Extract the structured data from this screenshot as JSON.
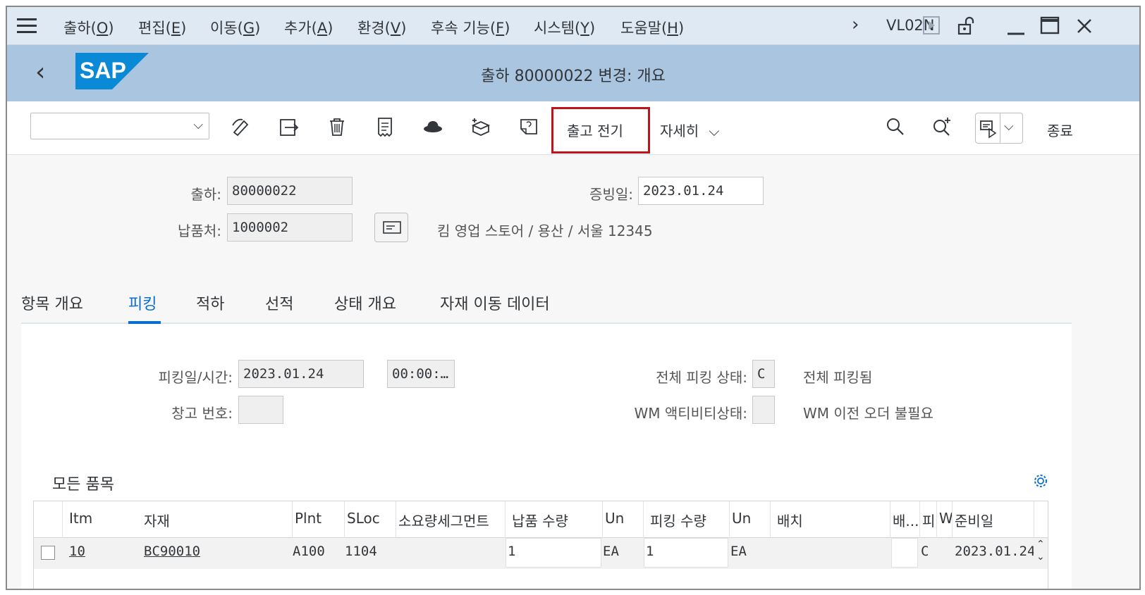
{
  "menu": {
    "items": [
      {
        "text": "출하(",
        "key": "O",
        "end": ")"
      },
      {
        "text": "편집(",
        "key": "E",
        "end": ")"
      },
      {
        "text": "이동(",
        "key": "G",
        "end": ")"
      },
      {
        "text": "추가(",
        "key": "A",
        "end": ")"
      },
      {
        "text": "환경(",
        "key": "V",
        "end": ")"
      },
      {
        "text": "후속 기능(",
        "key": "F",
        "end": ")"
      },
      {
        "text": "시스템(",
        "key": "Y",
        "end": ")"
      },
      {
        "text": "도움말(",
        "key": "H",
        "end": ")"
      }
    ],
    "tcode": "VL02N"
  },
  "title": {
    "text": "출하 80000022 변경: 개요",
    "logo": "SAP"
  },
  "toolbar": {
    "post_goods_issue": "출고 전기",
    "more": "자세히",
    "exit": "종료",
    "select_value": ""
  },
  "header": {
    "delivery_label": "출하:",
    "delivery_value": "80000022",
    "doc_date_label": "증빙일:",
    "doc_date_value": "2023.01.24",
    "shipto_label": "납품처:",
    "shipto_value": "1000002",
    "shipto_desc": "킴 영업 스토어 / 용산 / 서울 12345"
  },
  "tabs": [
    "항목 개요",
    "피킹",
    "적하",
    "선적",
    "상태 개요",
    "자재 이동 데이터"
  ],
  "picking": {
    "date_label": "피킹일/시간:",
    "date_value": "2023.01.24",
    "time_value": "00:00:…",
    "warehouse_label": "창고 번호:",
    "warehouse_value": "",
    "overall_status_label": "전체 피킹 상태:",
    "overall_status_value": "C",
    "overall_status_desc": "전체 피킹됨",
    "wm_status_label": "WM 액티비티상태:",
    "wm_status_value": "",
    "wm_status_desc": "WM 이전 오더 불필요"
  },
  "items": {
    "title": "모든 품목",
    "columns": [
      "Itm",
      "자재",
      "Plnt",
      "SLoc",
      "소요량세그먼트",
      "납품 수량",
      "Un",
      "피킹 수량",
      "Un",
      "배치",
      "배...",
      "피",
      "W",
      "준비일"
    ],
    "rows": [
      {
        "itm": "10",
        "material": "BC90010",
        "plnt": "A100",
        "sloc": "1104",
        "segment": "",
        "deliv_qty": "1",
        "un": "EA",
        "pick_qty": "1",
        "un2": "EA",
        "batch": "",
        "col_b": "",
        "pick_status": "C",
        "wm": "",
        "avail_date": "2023.01.24"
      }
    ]
  },
  "colors": {
    "menubar": "#dfe9f4",
    "titlebar": "#aac5df",
    "accent": "#0a6ed1",
    "highlight": "#c0141c"
  }
}
